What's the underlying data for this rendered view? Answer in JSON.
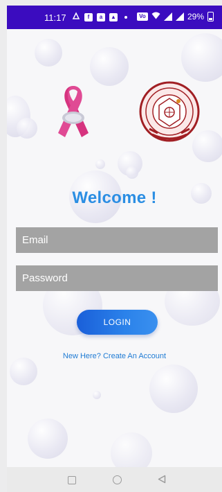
{
  "status_bar": {
    "time": "11:17",
    "battery_percent": "29%",
    "icons": [
      "vpn-icon",
      "notification-icon",
      "app-icon",
      "image-icon",
      "wifi-icon",
      "signal-icon",
      "battery-icon"
    ]
  },
  "logos": {
    "left": "pink-ribbon-logo",
    "right": "institute-seal-logo"
  },
  "main": {
    "welcome_text": "Welcome !",
    "email_placeholder": "Email",
    "password_placeholder": "Password",
    "login_label": "LOGIN",
    "create_account_link": "New Here? Create An Account"
  },
  "nav_bar": {
    "buttons": [
      "recents-icon",
      "home-icon",
      "back-icon"
    ]
  },
  "colors": {
    "status_bar": "#3b0cbf",
    "accent": "#2b8ee3",
    "field_bg": "#a3a3a3",
    "ribbon": "#d6337f"
  }
}
